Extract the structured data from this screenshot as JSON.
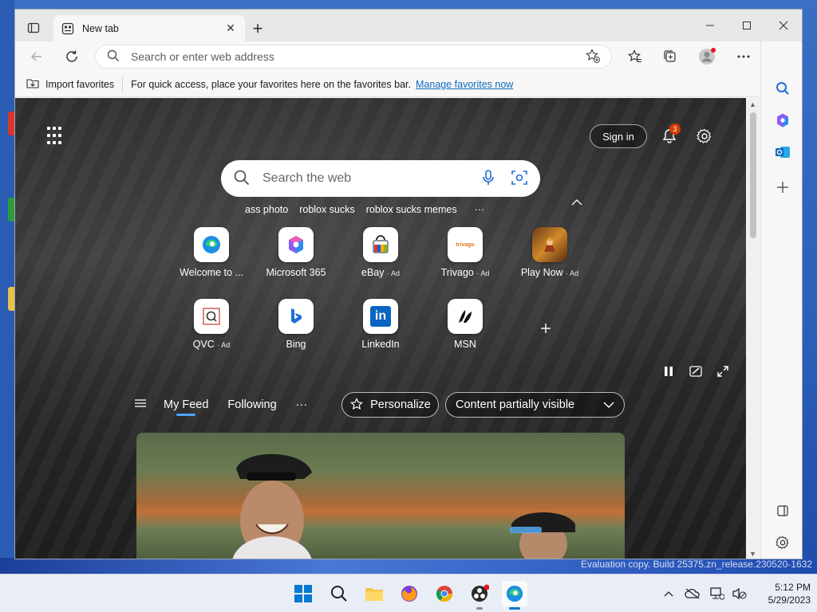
{
  "window": {
    "tab_title": "New tab",
    "address_placeholder": "Search or enter web address"
  },
  "favorites_bar": {
    "import_label": "Import favorites",
    "message": "For quick access, place your favorites here on the favorites bar.",
    "link": "Manage favorites now"
  },
  "ntp": {
    "sign_in_label": "Sign in",
    "notification_count": "3",
    "search_placeholder": "Search the web",
    "trending": [
      "ass photo",
      "roblox sucks",
      "roblox sucks memes"
    ],
    "more_label": "···",
    "tiles_row1": [
      {
        "label": "Welcome to ...",
        "ad": "",
        "icon": "edge-icon"
      },
      {
        "label": "Microsoft 365",
        "ad": "",
        "icon": "microsoft365-icon"
      },
      {
        "label": "eBay",
        "ad": "· Ad",
        "icon": "ebay-icon"
      },
      {
        "label": "Trivago",
        "ad": "· Ad",
        "icon": "trivago-icon"
      },
      {
        "label": "Play Now",
        "ad": "· Ad",
        "icon": "game-icon"
      }
    ],
    "tiles_row2": [
      {
        "label": "QVC",
        "ad": "· Ad",
        "icon": "qvc-icon"
      },
      {
        "label": "Bing",
        "ad": "",
        "icon": "bing-icon"
      },
      {
        "label": "LinkedIn",
        "ad": "",
        "icon": "linkedin-icon"
      },
      {
        "label": "MSN",
        "ad": "",
        "icon": "msn-icon"
      }
    ],
    "trivago_logo_text": "trivago",
    "linkedin_logo_text": "in"
  },
  "feed": {
    "tabs": [
      "My Feed",
      "Following"
    ],
    "more_label": "···",
    "personalize_label": "Personalize",
    "visibility_label": "Content partially visible"
  },
  "taskbar": {
    "time": "5:12 PM",
    "date": "5/29/2023"
  },
  "desktop": {
    "watermark": "Evaluation copy. Build 25375.zn_release.230520-1632"
  },
  "colors": {
    "accent": "#0f6cbd",
    "badge": "#d83b01",
    "feed_active": "#4fa3ff"
  }
}
